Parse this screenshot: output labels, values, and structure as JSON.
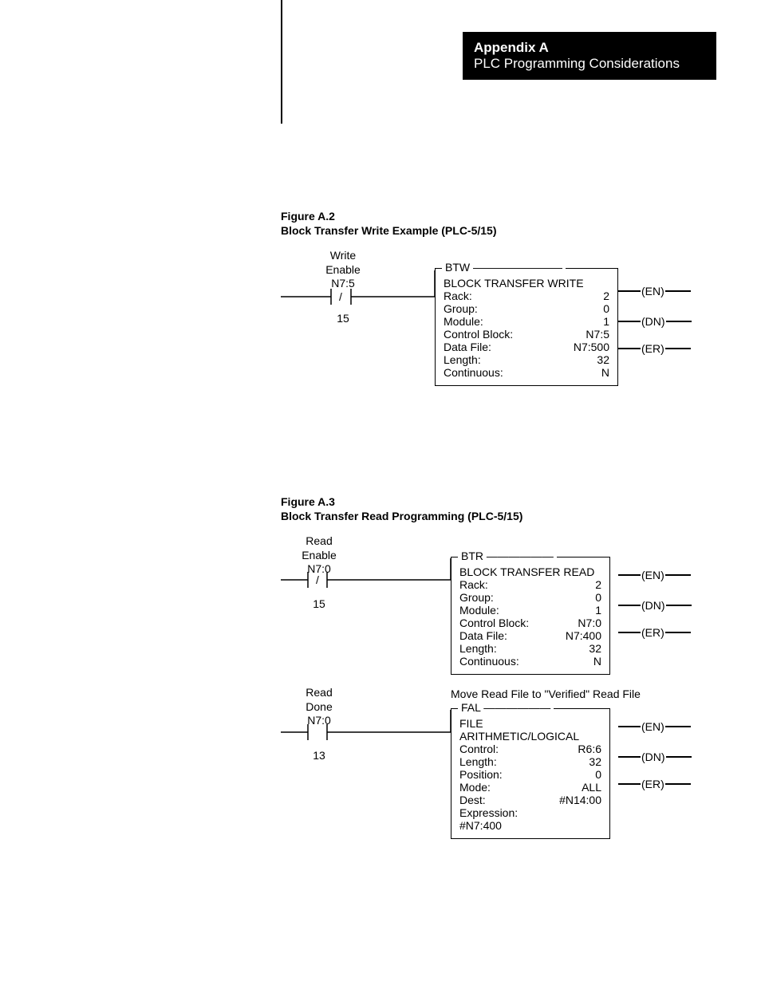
{
  "header": {
    "appendix": "Appendix A",
    "title": "PLC Programming Considerations"
  },
  "figureA2": {
    "number": "Figure A.2",
    "caption": "Block Transfer Write Example (PLC-5/15)",
    "contact": {
      "line1": "Write",
      "line2": "Enable",
      "address": "N7:5",
      "bit": "15",
      "type": "XIO"
    },
    "block": {
      "mnemonic": "BTW",
      "description": "BLOCK TRANSFER WRITE",
      "params": [
        {
          "label": "Rack:",
          "value": "2"
        },
        {
          "label": "Group:",
          "value": "0"
        },
        {
          "label": "Module:",
          "value": "1"
        },
        {
          "label": "Control Block:",
          "value": "N7:5"
        },
        {
          "label": "Data File:",
          "value": "N7:500"
        },
        {
          "label": "Length:",
          "value": "32"
        },
        {
          "label": "Continuous:",
          "value": "N"
        }
      ]
    },
    "outputs": [
      "(EN)",
      "(DN)",
      "(ER)"
    ]
  },
  "figureA3": {
    "number": "Figure A.3",
    "caption": "Block Transfer Read Programming (PLC-5/15)",
    "rung1": {
      "contact": {
        "line1": "Read",
        "line2": "Enable",
        "address": "N7:0",
        "bit": "15",
        "type": "XIO"
      },
      "block": {
        "mnemonic": "BTR",
        "description": "BLOCK TRANSFER READ",
        "params": [
          {
            "label": "Rack:",
            "value": "2"
          },
          {
            "label": "Group:",
            "value": "0"
          },
          {
            "label": "Module:",
            "value": "1"
          },
          {
            "label": "Control Block:",
            "value": "N7:0"
          },
          {
            "label": "Data File:",
            "value": "N7:400"
          },
          {
            "label": "Length:",
            "value": "32"
          },
          {
            "label": "Continuous:",
            "value": "N"
          }
        ]
      },
      "outputs": [
        "(EN)",
        "(DN)",
        "(ER)"
      ]
    },
    "rung2": {
      "contact": {
        "line1": "Read",
        "line2": "Done",
        "address": "N7:0",
        "bit": "13",
        "type": "XIC"
      },
      "comment": "Move Read File to \"Verified\" Read File",
      "block": {
        "mnemonic": "FAL",
        "description": "FILE ARITHMETIC/LOGICAL",
        "params": [
          {
            "label": "Control:",
            "value": "R6:6"
          },
          {
            "label": "Length:",
            "value": "32"
          },
          {
            "label": "Position:",
            "value": "0"
          },
          {
            "label": "Mode:",
            "value": "ALL"
          },
          {
            "label": "Dest:",
            "value": "#N14:00"
          },
          {
            "label": "Expression:",
            "value": ""
          },
          {
            "label": "#N7:400",
            "value": ""
          }
        ]
      },
      "outputs": [
        "(EN)",
        "(DN)",
        "(ER)"
      ]
    }
  }
}
